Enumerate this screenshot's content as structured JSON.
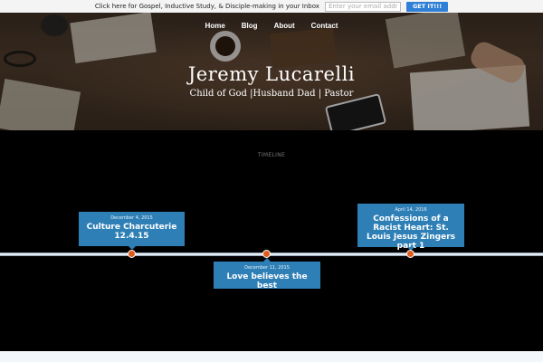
{
  "promo_bar": {
    "message": "Click here for Gospel, Inductive Study, & Disciple-making in your Inbox",
    "email_placeholder": "Enter your email address",
    "button_label": "GET IT!!!"
  },
  "nav": {
    "items": [
      "Home",
      "Blog",
      "About",
      "Contact"
    ]
  },
  "hero": {
    "site_title": "Jeremy Lucarelli",
    "tagline": "Child of God |Husband Dad | Pastor"
  },
  "timeline": {
    "heading": "TIMELINE",
    "entries": [
      {
        "date": "December 4, 2015",
        "title": "Culture Charcuterie 12.4.15"
      },
      {
        "date": "December 11, 2015",
        "title": "Love believes the best"
      },
      {
        "date": "April 14, 2016",
        "title": "Confessions of a Racist Heart: St. Louis Jesus Zingers part 1"
      }
    ]
  },
  "colors": {
    "accent": "#2f7fd6",
    "card": "#2e7fb6",
    "dot": "#e05a1a"
  }
}
